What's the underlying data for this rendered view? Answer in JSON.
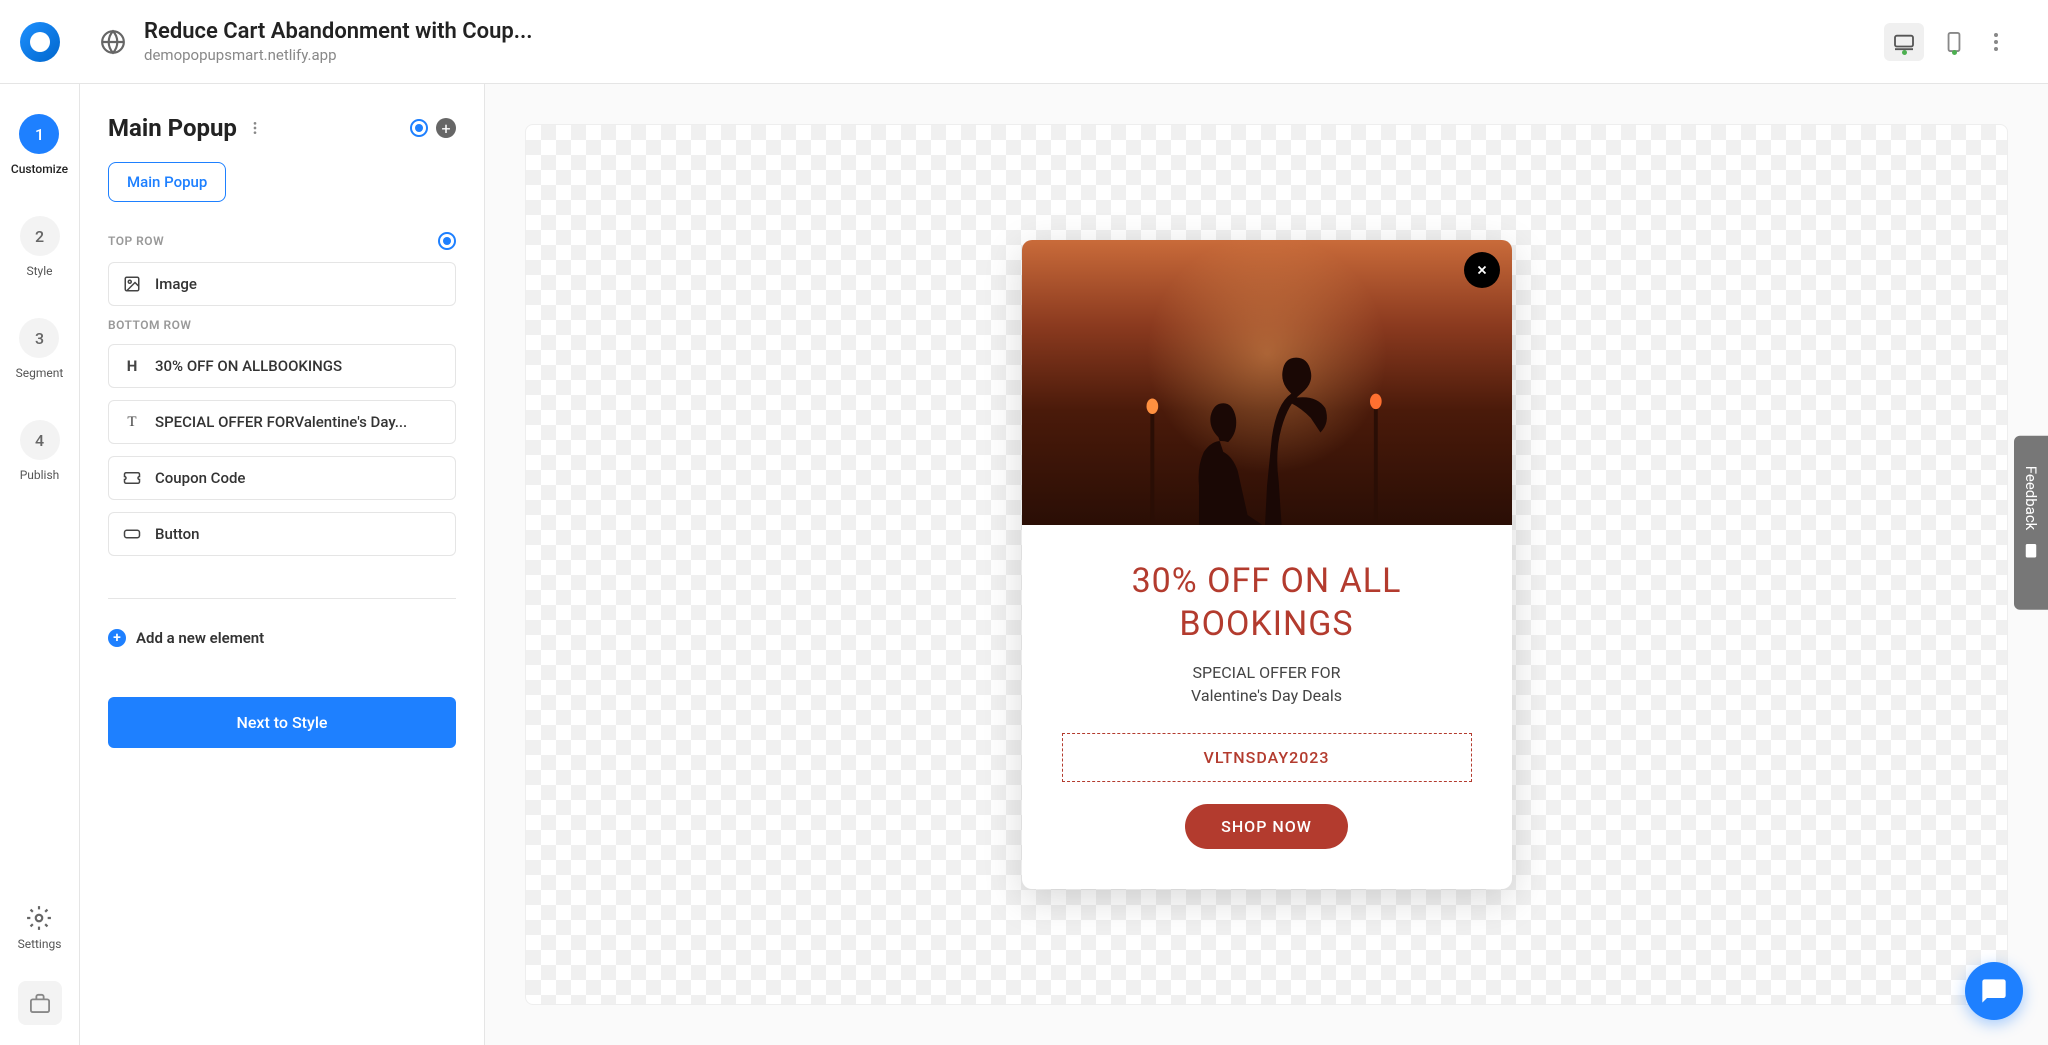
{
  "header": {
    "title": "Reduce Cart Abandonment with Coup...",
    "url": "demopopupsmart.netlify.app"
  },
  "nav": {
    "steps": [
      {
        "num": "1",
        "label": "Customize",
        "active": true
      },
      {
        "num": "2",
        "label": "Style",
        "active": false
      },
      {
        "num": "3",
        "label": "Segment",
        "active": false
      },
      {
        "num": "4",
        "label": "Publish",
        "active": false
      }
    ],
    "settings_label": "Settings"
  },
  "sidebar": {
    "title": "Main Popup",
    "tab_label": "Main Popup",
    "sections": {
      "top_label": "TOP ROW",
      "bottom_label": "BOTTOM ROW"
    },
    "top_items": [
      {
        "label": "Image"
      }
    ],
    "bottom_items": [
      {
        "icon": "H",
        "label": "30% OFF ON ALLBOOKINGS"
      },
      {
        "icon": "T",
        "label": "SPECIAL OFFER FORValentine's Day..."
      },
      {
        "icon": "ticket",
        "label": "Coupon Code"
      },
      {
        "icon": "button",
        "label": "Button"
      }
    ],
    "add_element_label": "Add a new element",
    "next_btn_label": "Next to Style"
  },
  "popup": {
    "heading": "30% OFF ON ALL BOOKINGS",
    "sub1": "SPECIAL OFFER FOR",
    "sub2": "Valentine's Day Deals",
    "coupon": "VLTNSDAY2023",
    "cta": "SHOP NOW"
  },
  "feedback_label": "Feedback"
}
